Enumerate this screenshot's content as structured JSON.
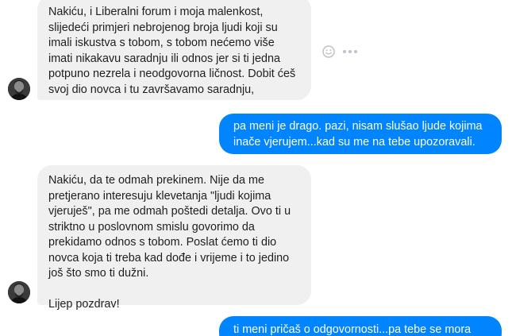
{
  "conversation": {
    "messages": [
      {
        "direction": "incoming",
        "text": "Nakiću, i Liberalni forum i moja malenkost, slijedeći primjeri nebrojenog broja ljudi koji su imali iskustva s tobom, s tobom nećemo više imati nikakavu saradnju ili odnos jer si ti jedna potpuno nezrela i neodgovorna ličnost. Dobit ćeš svoj dio novca i tu završavamo saradnju,"
      },
      {
        "direction": "outgoing",
        "text": "pa meni je drago. pazi, nisam slušao ljude kojima inače vjerujem...kad su me na tebe upozoravali."
      },
      {
        "direction": "incoming",
        "text": "Nakiću, da te odmah prekinem. Nije da me pretjerano interesuju klevetanja \"ljudi kojima vjeruješ\", pa me odmah poštedi detalja. Ovo ti u striktno u poslovnom smislu govorimo da prekidamo odnos s tobom. Poslat ćemo ti dio novca koja ti treba kad dođe i vrijeme i to jedino još što smo ti dužni.\n\nLijep pozdrav!"
      },
      {
        "direction": "outgoing",
        "text": "ti meni pričaš o odgovornosti...pa tebe se mora"
      }
    ]
  },
  "icons": {
    "reaction": "smile-icon",
    "more": "more-options-icon",
    "avatar": "avatar"
  },
  "colors": {
    "incoming_bubble": "#f1f0f0",
    "outgoing_bubble": "#0084ff",
    "incoming_text": "#1c1e21",
    "outgoing_text": "#ffffff"
  }
}
